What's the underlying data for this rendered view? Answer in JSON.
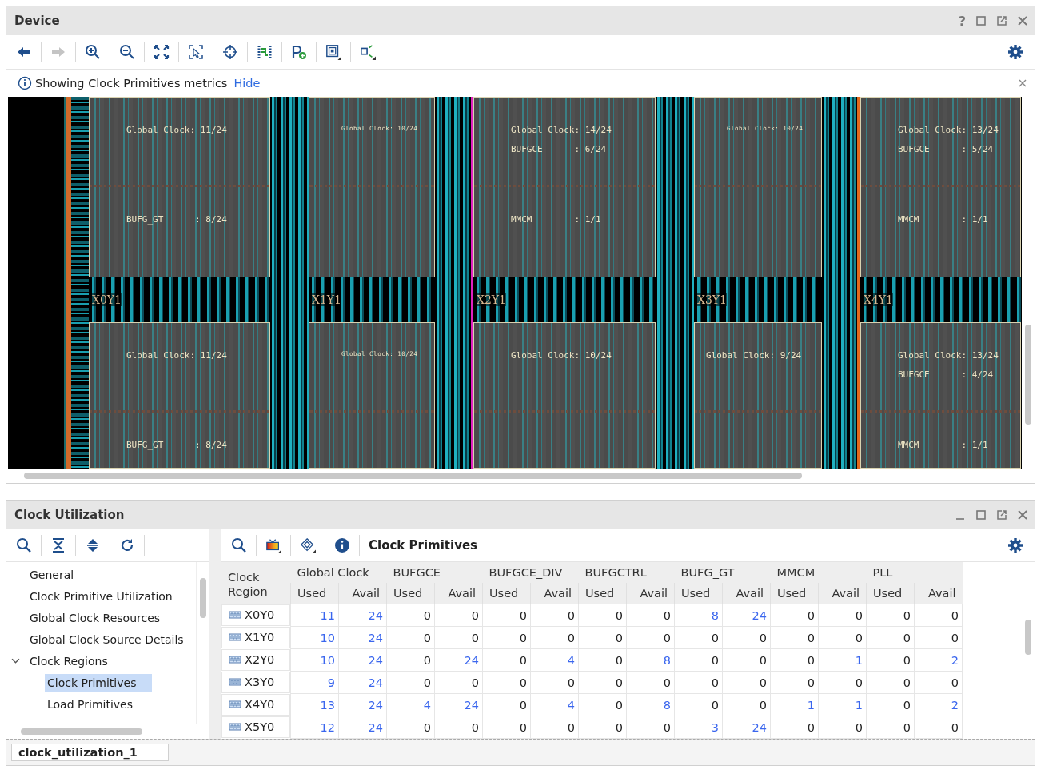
{
  "device": {
    "title": "Device",
    "help": "?",
    "forward_disabled": true,
    "info": {
      "text": "Showing Clock Primitives metrics",
      "link": "Hide"
    },
    "columns": [
      {
        "label": "X0Y1",
        "top": {
          "kind": "normal",
          "upper": [
            "Global Clock: 11/24"
          ],
          "lower": [
            "BUFG_GT      : 8/24"
          ]
        },
        "bottom": {
          "kind": "normal",
          "upper": [
            "Global Clock: 11/24"
          ],
          "lower": [
            "BUFG_GT      : 8/24"
          ]
        }
      },
      {
        "label": "X1Y1",
        "top": {
          "kind": "small",
          "upper": [
            "Global Clock: 10/24"
          ]
        },
        "bottom": {
          "kind": "small",
          "upper": [
            "Global Clock: 10/24"
          ]
        }
      },
      {
        "label": "X2Y1",
        "top": {
          "kind": "normal",
          "upper": [
            "Global Clock: 14/24",
            "BUFGCE      : 6/24"
          ],
          "lower": [
            "MMCM        : 1/1"
          ]
        },
        "bottom": {
          "kind": "normal",
          "upper": [
            "Global Clock: 10/24"
          ]
        }
      },
      {
        "label": "X3Y1",
        "top": {
          "kind": "small",
          "upper": [
            "Global Clock: 10/24"
          ]
        },
        "bottom": {
          "kind": "normal",
          "upper": [
            "Global Clock: 9/24"
          ]
        }
      },
      {
        "label": "X4Y1",
        "top": {
          "kind": "normal",
          "upper": [
            "Global Clock: 13/24",
            "BUFGCE      : 5/24"
          ],
          "lower": [
            "MMCM        : 1/1"
          ]
        },
        "bottom": {
          "kind": "normal",
          "upper": [
            "Global Clock: 13/24",
            "BUFGCE      : 4/24"
          ],
          "lower": [
            "MMCM        : 1/1"
          ]
        }
      }
    ]
  },
  "clock_utilization": {
    "title": "Clock Utilization",
    "table_title": "Clock Primitives",
    "tree": [
      {
        "label": "General",
        "selected": false
      },
      {
        "label": "Clock Primitive Utilization",
        "selected": false
      },
      {
        "label": "Global Clock Resources",
        "selected": false
      },
      {
        "label": "Global Clock Source Details",
        "selected": false
      },
      {
        "label": "Clock Regions",
        "selected": false,
        "expanded": true,
        "children": [
          {
            "label": "Clock Primitives",
            "selected": true
          },
          {
            "label": "Load Primitives",
            "selected": false
          }
        ]
      }
    ],
    "table": {
      "first_column": "Clock Region",
      "groups": [
        {
          "label": "Global Clock",
          "sub": [
            "Used",
            "Avail"
          ]
        },
        {
          "label": "BUFGCE",
          "sub": [
            "Used",
            "Avail"
          ]
        },
        {
          "label": "BUFGCE_DIV",
          "sub": [
            "Used",
            "Avail"
          ]
        },
        {
          "label": "BUFGCTRL",
          "sub": [
            "Used",
            "Avail"
          ]
        },
        {
          "label": "BUFG_GT",
          "sub": [
            "Used",
            "Avail"
          ]
        },
        {
          "label": "MMCM",
          "sub": [
            "Used",
            "Avail"
          ]
        },
        {
          "label": "PLL",
          "sub": [
            "Used",
            "Avail"
          ]
        }
      ],
      "rows": [
        {
          "region": "X0Y0",
          "cells": [
            "11",
            "24",
            "0",
            "0",
            "0",
            "0",
            "0",
            "0",
            "8",
            "24",
            "0",
            "0",
            "0",
            "0"
          ],
          "links": [
            true,
            true,
            false,
            false,
            false,
            false,
            false,
            false,
            true,
            true,
            false,
            false,
            false,
            false
          ]
        },
        {
          "region": "X1Y0",
          "cells": [
            "10",
            "24",
            "0",
            "0",
            "0",
            "0",
            "0",
            "0",
            "0",
            "0",
            "0",
            "0",
            "0",
            "0"
          ],
          "links": [
            true,
            true,
            false,
            false,
            false,
            false,
            false,
            false,
            false,
            false,
            false,
            false,
            false,
            false
          ]
        },
        {
          "region": "X2Y0",
          "cells": [
            "10",
            "24",
            "0",
            "24",
            "0",
            "4",
            "0",
            "8",
            "0",
            "0",
            "0",
            "1",
            "0",
            "2"
          ],
          "links": [
            true,
            true,
            false,
            true,
            false,
            true,
            false,
            true,
            false,
            false,
            false,
            true,
            false,
            true
          ]
        },
        {
          "region": "X3Y0",
          "cells": [
            "9",
            "24",
            "0",
            "0",
            "0",
            "0",
            "0",
            "0",
            "0",
            "0",
            "0",
            "0",
            "0",
            "0"
          ],
          "links": [
            true,
            true,
            false,
            false,
            false,
            false,
            false,
            false,
            false,
            false,
            false,
            false,
            false,
            false
          ]
        },
        {
          "region": "X4Y0",
          "cells": [
            "13",
            "24",
            "4",
            "24",
            "0",
            "4",
            "0",
            "8",
            "0",
            "0",
            "1",
            "1",
            "0",
            "2"
          ],
          "links": [
            true,
            true,
            true,
            true,
            false,
            true,
            false,
            true,
            false,
            false,
            true,
            true,
            false,
            true
          ]
        },
        {
          "region": "X5Y0",
          "cells": [
            "12",
            "24",
            "0",
            "0",
            "0",
            "0",
            "0",
            "0",
            "3",
            "24",
            "0",
            "0",
            "0",
            "0"
          ],
          "links": [
            true,
            true,
            false,
            false,
            false,
            false,
            false,
            false,
            true,
            true,
            false,
            false,
            false,
            false
          ]
        }
      ]
    },
    "tab": "clock_utilization_1"
  }
}
